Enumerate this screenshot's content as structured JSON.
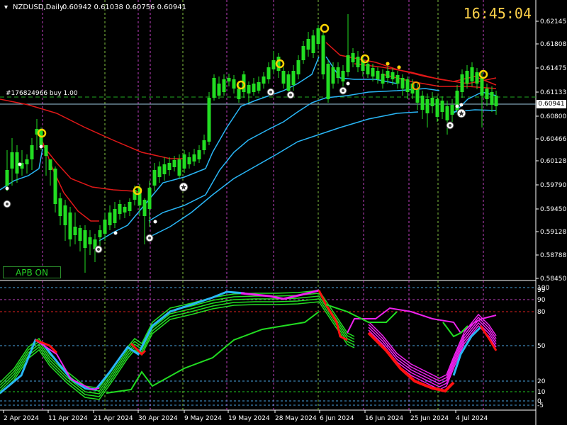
{
  "header": {
    "symbol": "NZDUSD,Daily",
    "ohlc": "0.60942 0.61038 0.60756 0.60941",
    "menu_icon": "triangle-down-icon"
  },
  "clock": "16:45:04",
  "order_line": "#176824966 buy 1.00",
  "current_price": "0.60941",
  "panel_button": "APB ON",
  "price_axis": [
    "0.62145",
    "0.61808",
    "0.61475",
    "0.61133",
    "0.60800",
    "0.60466",
    "0.60128",
    "0.59790",
    "0.59450",
    "0.59128",
    "0.58788",
    "0.58450"
  ],
  "osc_axis": [
    "100",
    "99",
    "90",
    "80",
    "50",
    "20",
    "10",
    "0",
    "-5"
  ],
  "date_axis": [
    "2 Apr 2024",
    "11 Apr 2024",
    "21 Apr 2024",
    "30 Apr 2024",
    "9 May 2024",
    "19 May 2024",
    "28 May 2024",
    "6 Jun 2024",
    "16 Jun 2024",
    "25 Jun 2024",
    "4 Jul 2024"
  ],
  "colors": {
    "bull": "#22dd22",
    "bear": "#ee22ee",
    "ma_red": "#e01818",
    "ma_blue": "#29b6f6",
    "marker_yellow": "#ffd400",
    "grid_v": "#c040c0",
    "grid_v2": "#7fbf3f",
    "osc_green": "#22dd22",
    "osc_pink": "#ee22ee",
    "osc_blue": "#29b6f6",
    "osc_red": "#ff1111"
  }
}
